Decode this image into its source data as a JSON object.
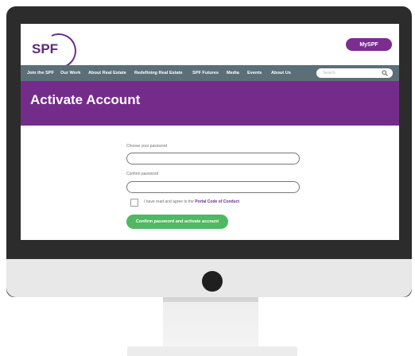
{
  "header": {
    "logo_text": "SPF",
    "myspf_label": "MySPF"
  },
  "nav": {
    "items": [
      {
        "label": "Join the SPF"
      },
      {
        "label": "Our Work"
      },
      {
        "label": "About Real Estate"
      },
      {
        "label": "Redefining Real Estate"
      },
      {
        "label": "SPF Futures"
      },
      {
        "label": "Media"
      },
      {
        "label": "Events"
      },
      {
        "label": "About Us"
      }
    ],
    "search_placeholder": "Search"
  },
  "hero": {
    "title": "Activate Account"
  },
  "form": {
    "password_label": "Choose your password",
    "password_value": "",
    "confirm_label": "Confirm password",
    "confirm_value": "",
    "agree_text": "I have read and agree to the",
    "agree_link": "Portal Code of Conduct",
    "agree_checked": false,
    "submit_label": "Confirm password and activate account"
  },
  "colors": {
    "brand_purple": "#742c8b",
    "nav_bg": "#5b6f78",
    "submit_green": "#4fb862"
  },
  "icons": [
    "search-icon",
    "power-button-icon"
  ]
}
